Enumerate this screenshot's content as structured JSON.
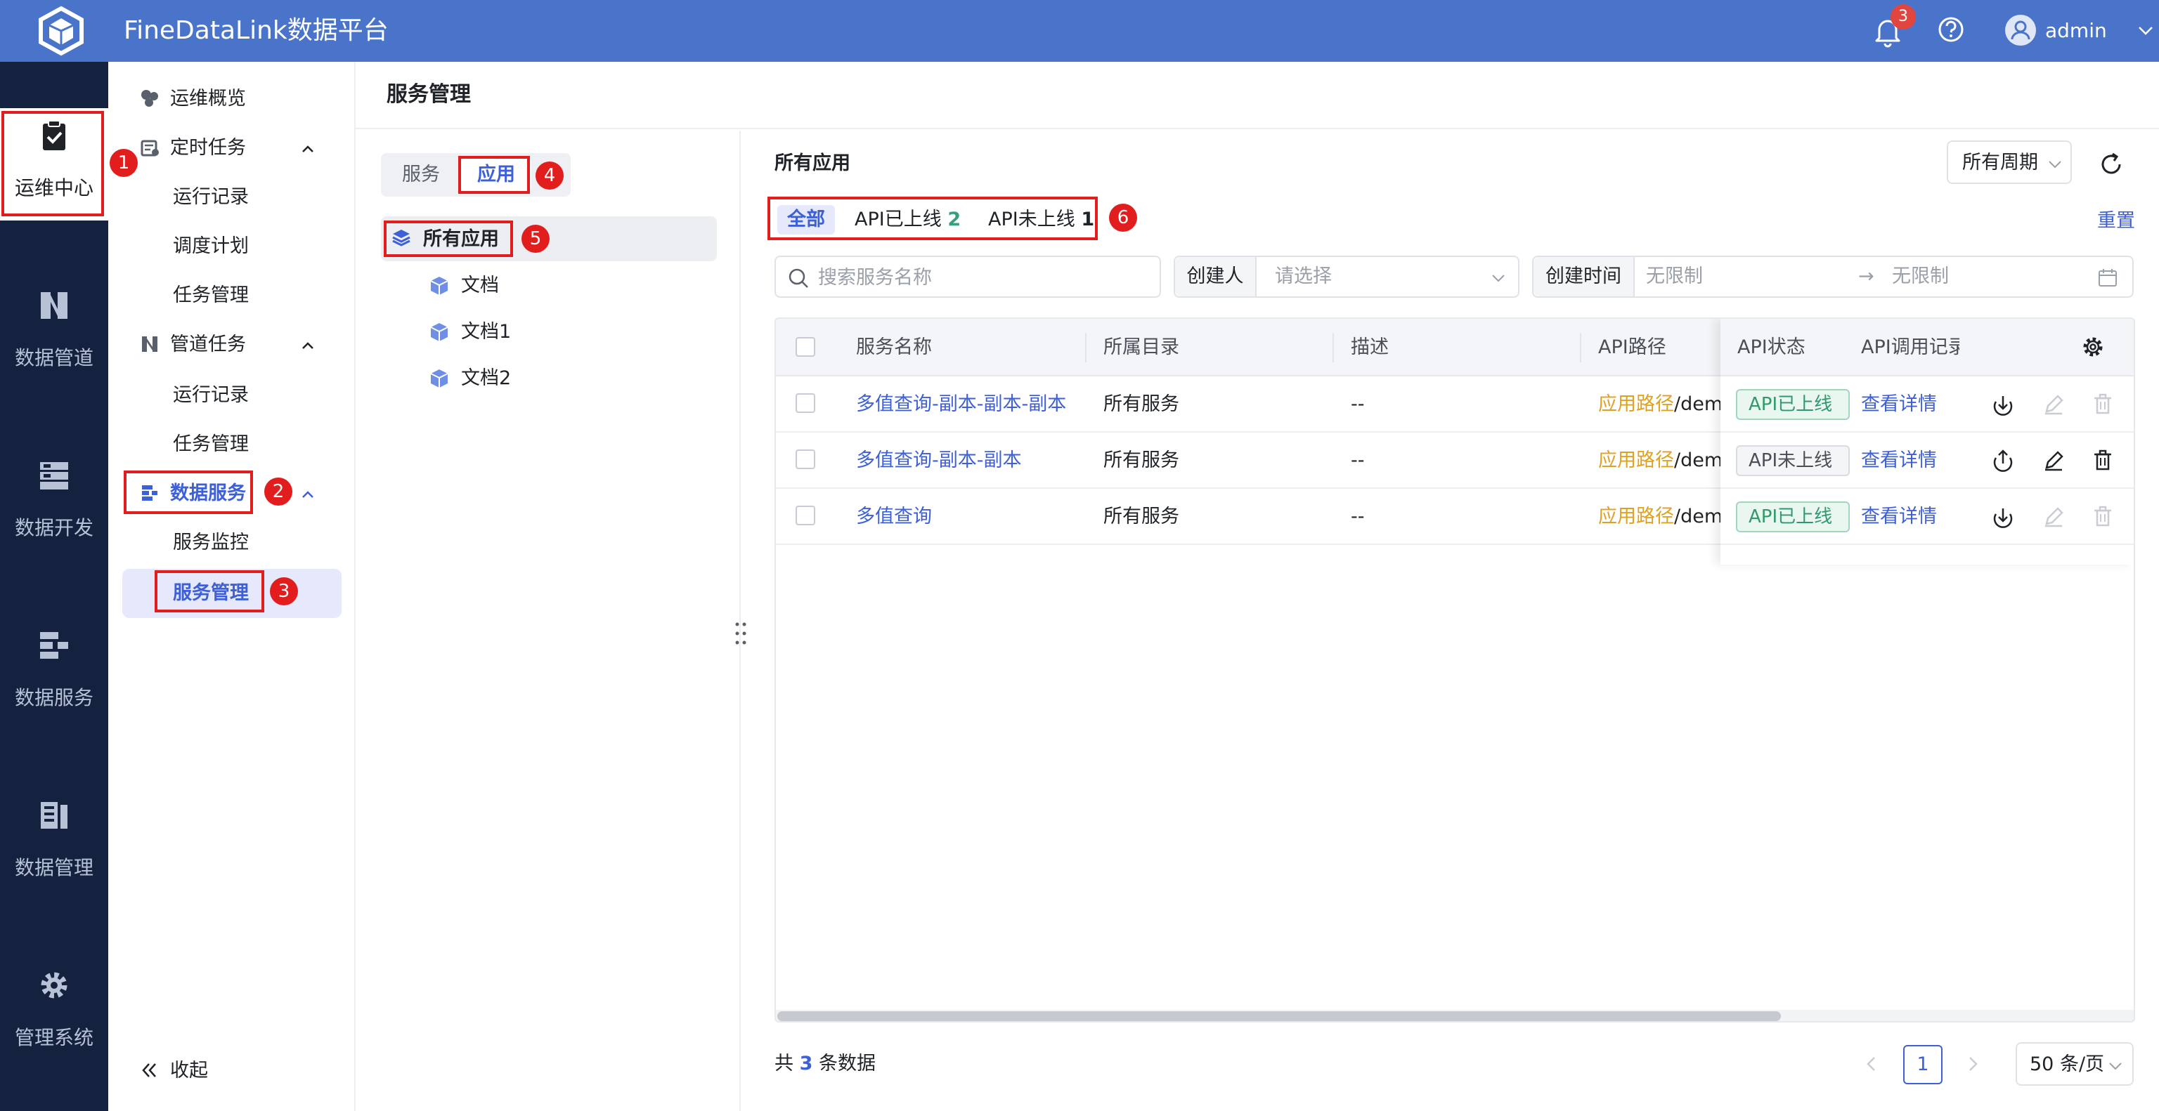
{
  "app": {
    "title": "FineDataLink数据平台",
    "notification_count": "3",
    "user": "admin"
  },
  "leftnav": [
    {
      "label": "运维中心",
      "icon": "clipboard-check-icon"
    },
    {
      "label": "数据管道",
      "icon": "pipeline-icon"
    },
    {
      "label": "数据开发",
      "icon": "server-stack-icon"
    },
    {
      "label": "数据服务",
      "icon": "service-flow-icon"
    },
    {
      "label": "数据管理",
      "icon": "data-manage-icon"
    },
    {
      "label": "管理系统",
      "icon": "gear-icon"
    }
  ],
  "subnav": {
    "overview": "运维概览",
    "scheduled": {
      "label": "定时任务",
      "children": [
        "运行记录",
        "调度计划",
        "任务管理"
      ]
    },
    "pipeline": {
      "label": "管道任务",
      "children": [
        "运行记录",
        "任务管理"
      ]
    },
    "dataservice": {
      "label": "数据服务",
      "children": [
        "服务监控",
        "服务管理"
      ]
    },
    "collapse": "收起"
  },
  "page": {
    "title": "服务管理"
  },
  "tree": {
    "segments": [
      "服务",
      "应用"
    ],
    "root": "所有应用",
    "children": [
      "文档",
      "文档1",
      "文档2"
    ]
  },
  "main": {
    "title": "所有应用",
    "period": "所有周期",
    "filter_tabs": {
      "all": "全部",
      "online": "API已上线",
      "online_count": "2",
      "offline": "API未上线",
      "offline_count": "1"
    },
    "reset": "重置",
    "search_placeholder": "搜索服务名称",
    "creator_label": "创建人",
    "creator_placeholder": "请选择",
    "time_label": "创建时间",
    "time_start": "无限制",
    "time_arrow": "→",
    "time_end": "无限制"
  },
  "table": {
    "headers": [
      "服务名称",
      "所属目录",
      "描述",
      "API路径",
      "API状态",
      "API调用记录"
    ],
    "rows": [
      {
        "name": "多值查询-副本-副本-副本",
        "dir": "所有服务",
        "desc": "--",
        "path_prefix": "应用路径",
        "path": "/demo",
        "status": "API已上线",
        "detail": "查看详情"
      },
      {
        "name": "多值查询-副本-副本",
        "dir": "所有服务",
        "desc": "--",
        "path_prefix": "应用路径",
        "path": "/demo",
        "status": "API未上线",
        "detail": "查看详情"
      },
      {
        "name": "多值查询",
        "dir": "所有服务",
        "desc": "--",
        "path_prefix": "应用路径",
        "path": "/demo",
        "status": "API已上线",
        "detail": "查看详情"
      }
    ]
  },
  "footer": {
    "total_prefix": "共",
    "total": "3",
    "total_suffix": "条数据",
    "page": "1",
    "page_size": "50 条/页"
  },
  "annotations": [
    "1",
    "2",
    "3",
    "4",
    "5",
    "6"
  ],
  "colors": {
    "topbar": "#4a74c9",
    "sidebar": "#15223f",
    "accent": "#3d5fd8",
    "highlight": "#e11d1d",
    "online": "#2f9a6c"
  }
}
